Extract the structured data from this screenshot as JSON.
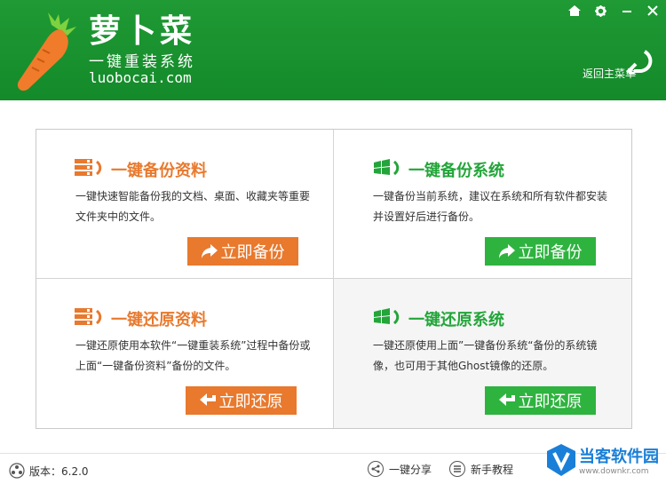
{
  "header": {
    "brand_name": "萝卜菜",
    "slogan": "一键重装系统",
    "url": "luobocai.com",
    "back_label": "返回主菜单",
    "controls": [
      "home-icon",
      "gear-icon",
      "minimize-icon",
      "close-icon"
    ]
  },
  "cards": {
    "backup_data": {
      "title": "一键备份资料",
      "desc": "一键快速智能备份我的文档、桌面、收藏夹等重要文件夹中的文件。",
      "button": "立即备份"
    },
    "backup_system": {
      "title": "一键备份系统",
      "desc": "一键备份当前系统，建议在系统和所有软件都安装并设置好后进行备份。",
      "button": "立即备份"
    },
    "restore_data": {
      "title": "一键还原资料",
      "desc": "一键还原使用本软件“一键重装系统”过程中备份或上面“一键备份资料”备份的文件。",
      "button": "立即还原"
    },
    "restore_system": {
      "title": "一键还原系统",
      "desc": "一键还原使用上面”一键备份系统“备份的系统镜像，也可用于其他Ghost镜像的还原。",
      "button": "立即还原"
    }
  },
  "footer": {
    "version": "版本：6.2.0",
    "share": "一键分享",
    "tutorial": "新手教程",
    "watermark_text": "当客软件园",
    "watermark_url": "www.downkr.com"
  },
  "colors": {
    "header_green": "#1a9530",
    "orange": "#e8792d",
    "green": "#2eb33f"
  }
}
